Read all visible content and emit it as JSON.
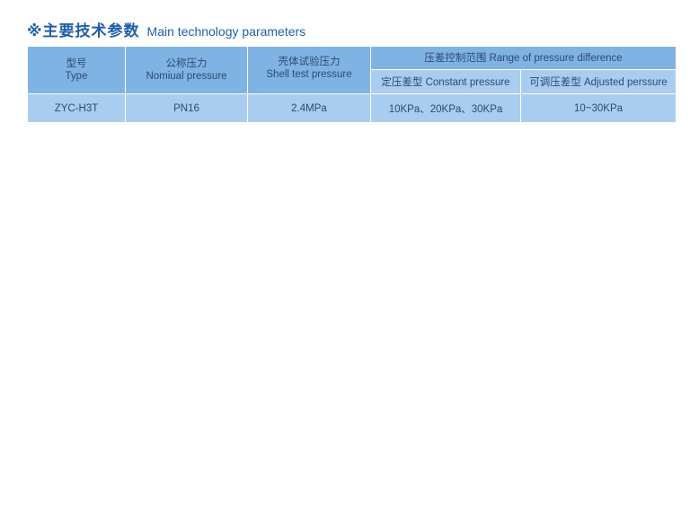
{
  "heading": {
    "marker": "※",
    "title_cn": "主要技术参数",
    "title_en": "Main technology parameters"
  },
  "table": {
    "columns": [
      {
        "cn": "型号",
        "en": "Type"
      },
      {
        "cn": "公称压力",
        "en": "Nomiual pressure"
      },
      {
        "cn": "壳体试验压力",
        "en": "Shell test pressure"
      },
      {
        "cn": "压差控制范围",
        "en": "Range of pressure difference"
      }
    ],
    "subcolumns": [
      "定压差型 Constant pressure",
      "可调压差型 Adjusted perssure"
    ],
    "rows": [
      [
        "ZYC-H3T",
        "PN16",
        "2.4MPa",
        "10KPa、20KPa、30KPa",
        "10~30KPa"
      ]
    ]
  },
  "colors": {
    "heading": "#1f5fa8",
    "header_bg": "#7fb3e4",
    "cell_bg": "#a9cdef",
    "text": "#2b4a6e"
  }
}
